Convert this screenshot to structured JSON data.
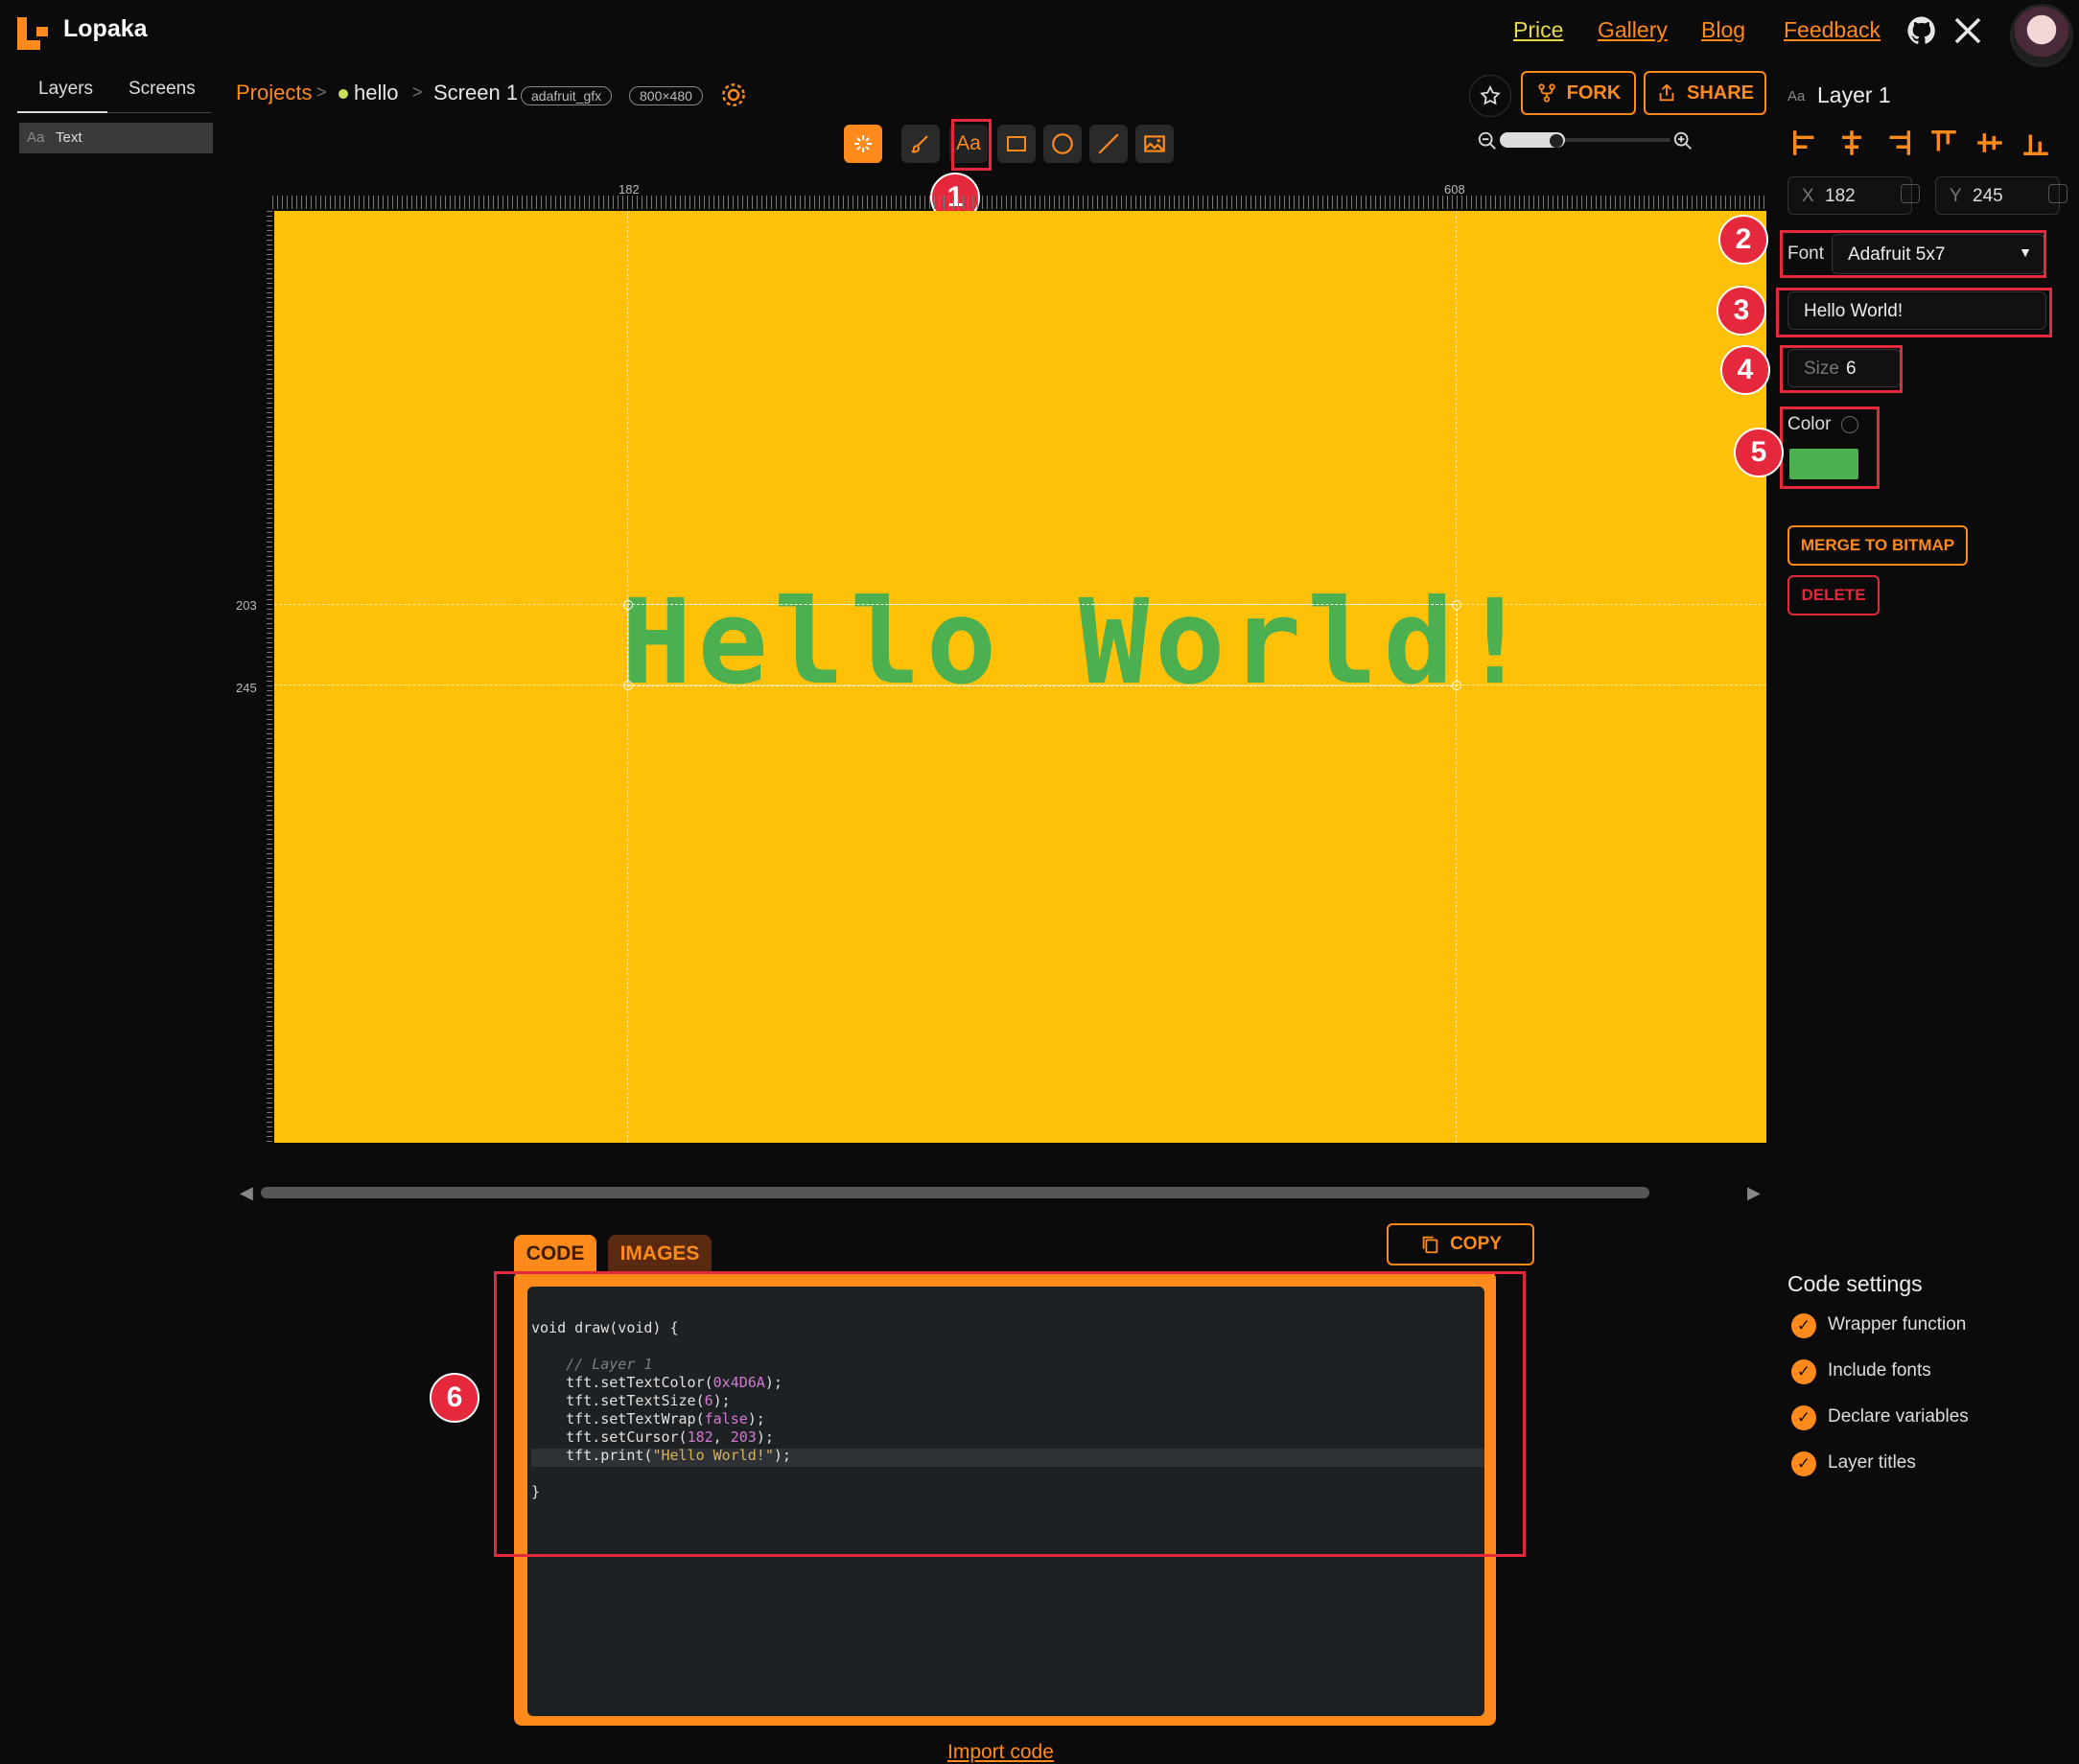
{
  "app": {
    "name": "Lopaka"
  },
  "nav": {
    "price": "Price",
    "gallery": "Gallery",
    "blog": "Blog",
    "feedback": "Feedback"
  },
  "left_panel": {
    "tabs": [
      "Layers",
      "Screens"
    ],
    "layers": [
      {
        "type_label": "Aa",
        "name": "Text"
      }
    ]
  },
  "breadcrumb": {
    "projects": "Projects",
    "sep": ">",
    "project": "hello",
    "screen": "Screen 1",
    "library": "adafruit_gfx",
    "resolution": "800×480"
  },
  "actions": {
    "fork": "FORK",
    "share": "SHARE"
  },
  "toolbar": {
    "text_tool_label": "Aa",
    "tools": [
      "select-tool",
      "brush-tool",
      "text-tool",
      "rectangle-tool",
      "circle-tool",
      "line-tool",
      "image-tool"
    ],
    "active": "select-tool"
  },
  "ruler": {
    "x1": "182",
    "x2": "608",
    "y1": "203",
    "y2": "245"
  },
  "canvas": {
    "text": "Hello World!",
    "background": "#ffc107",
    "text_color": "#4caf50"
  },
  "code_tabs": [
    "CODE",
    "IMAGES"
  ],
  "copy_label": "COPY",
  "code_lines": {
    "l1": "void draw(void) {",
    "l3": "// Layer 1",
    "l4a": "tft.setTextColor(",
    "l4b": "0x4D6A",
    "l4c": ");",
    "l5a": "tft.setTextSize(",
    "l5b": "6",
    "l5c": ");",
    "l6a": "tft.setTextWrap(",
    "l6b": "false",
    "l6c": ");",
    "l7a": "tft.setCursor(",
    "l7b": "182",
    "l7c": ", ",
    "l7d": "203",
    "l7e": ");",
    "l8a": "tft.print(",
    "l8b": "\"Hello World!\"",
    "l8c": ");",
    "l10": "}"
  },
  "import_code": "Import code",
  "inspector": {
    "type_label": "Aa",
    "layer_name": "Layer 1",
    "x_label": "X",
    "x_value": "182",
    "y_label": "Y",
    "y_value": "245",
    "font_label": "Font",
    "font_value": "Adafruit 5x7",
    "text_value": "Hello World!",
    "size_label": "Size",
    "size_value": "6",
    "color_label": "Color",
    "color_value": "#4caf50",
    "merge": "MERGE TO BITMAP",
    "delete": "DELETE"
  },
  "code_settings": {
    "title": "Code settings",
    "options": [
      "Wrapper function",
      "Include fonts",
      "Declare variables",
      "Layer titles"
    ]
  },
  "annotations": [
    "1",
    "2",
    "3",
    "4",
    "5",
    "6"
  ]
}
